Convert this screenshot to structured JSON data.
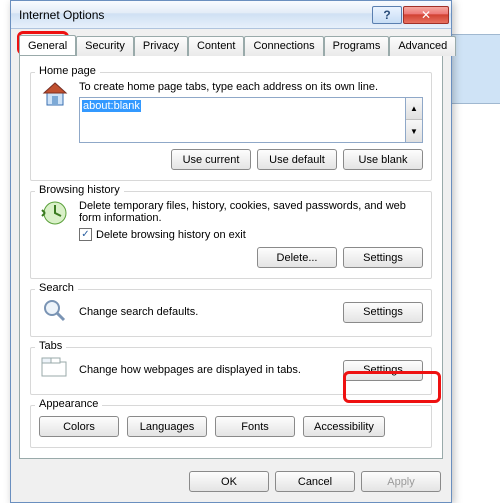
{
  "window": {
    "title": "Internet Options",
    "help_glyph": "?",
    "close_glyph": "✕"
  },
  "tabs": {
    "items": [
      "General",
      "Security",
      "Privacy",
      "Content",
      "Connections",
      "Programs",
      "Advanced"
    ],
    "active_index": 0
  },
  "homepage": {
    "legend": "Home page",
    "desc": "To create home page tabs, type each address on its own line.",
    "value": "about:blank",
    "btn_use_current": "Use current",
    "btn_use_default": "Use default",
    "btn_use_blank": "Use blank"
  },
  "history": {
    "legend": "Browsing history",
    "desc": "Delete temporary files, history, cookies, saved passwords, and web form information.",
    "checkbox_label": "Delete browsing history on exit",
    "checkbox_checked": true,
    "btn_delete": "Delete...",
    "btn_settings": "Settings"
  },
  "search": {
    "legend": "Search",
    "desc": "Change search defaults.",
    "btn_settings": "Settings"
  },
  "tabs_section": {
    "legend": "Tabs",
    "desc": "Change how webpages are displayed in tabs.",
    "btn_settings": "Settings"
  },
  "appearance": {
    "legend": "Appearance",
    "btn_colors": "Colors",
    "btn_languages": "Languages",
    "btn_fonts": "Fonts",
    "btn_accessibility": "Accessibility"
  },
  "footer": {
    "ok": "OK",
    "cancel": "Cancel",
    "apply": "Apply"
  },
  "spin": {
    "up": "▲",
    "down": "▼"
  },
  "checkmark": "✓"
}
